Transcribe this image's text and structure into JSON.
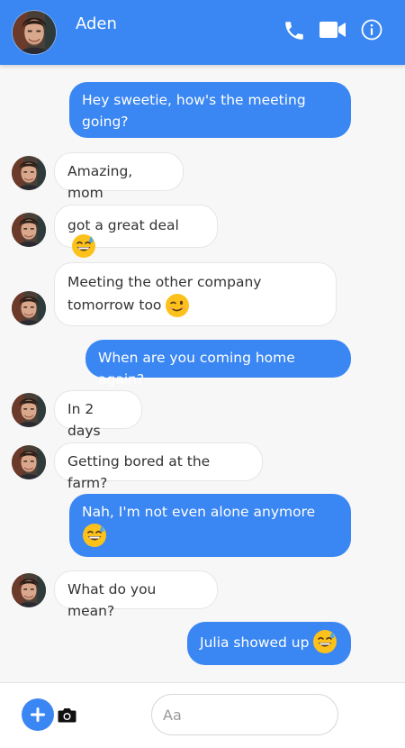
{
  "header": {
    "contact_name": "Aden",
    "icons": [
      "phone-icon",
      "video-camera-icon",
      "info-icon"
    ],
    "color": "#3a86f2"
  },
  "messages": [
    {
      "from": "me",
      "text": "Hey sweetie, how's the meeting going?"
    },
    {
      "from": "contact",
      "text": "Amazing, mom"
    },
    {
      "from": "contact",
      "text": "got a great deal",
      "emoji": "grinning-sweat-emoji"
    },
    {
      "from": "contact",
      "text": "Meeting the other company tomorrow too",
      "emoji": "winking-emoji"
    },
    {
      "from": "me",
      "text": "When are you coming home again?"
    },
    {
      "from": "contact",
      "text": "In 2 days"
    },
    {
      "from": "contact",
      "text": "Getting bored at the farm?"
    },
    {
      "from": "me",
      "text": "Nah, I'm not even alone anymore",
      "emoji": "grinning-sweat-emoji"
    },
    {
      "from": "contact",
      "text": "What do you mean?"
    },
    {
      "from": "me",
      "text": "Julia showed up",
      "emoji": "grinning-sweat-emoji"
    }
  ],
  "composer": {
    "placeholder": "Aa",
    "value": "",
    "icons": [
      "plus-icon",
      "camera-icon"
    ]
  }
}
